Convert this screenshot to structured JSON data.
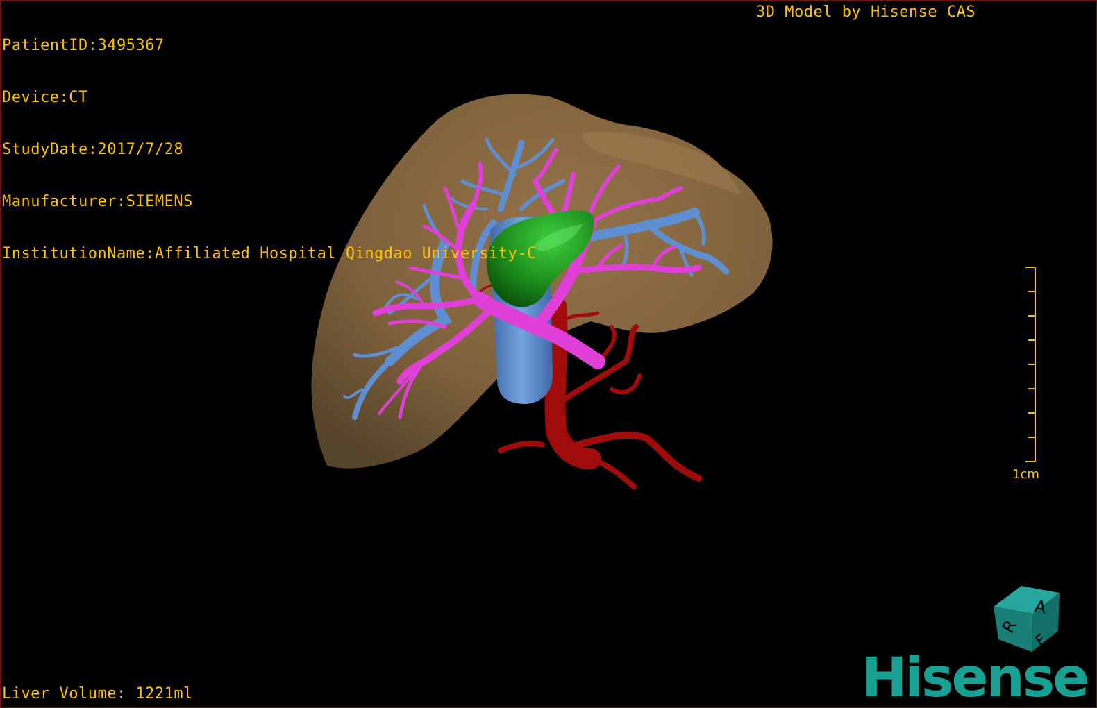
{
  "colors": {
    "overlay_text": "#ffc000",
    "liver": "#8f6d44",
    "hepatic_vein": "#5f8fd0",
    "portal_vein": "#e040d8",
    "hepatic_artery": "#a00c0c",
    "gallbladder": "#1a8a1a",
    "cube": "#1e8c84",
    "logo": "#18a093",
    "border": "#7a1010"
  },
  "dicom_info": {
    "patient_id": "PatientID:3495367",
    "device": "Device:CT",
    "study_date": "StudyDate:2017/7/28",
    "manufacturer": "Manufacturer:SIEMENS",
    "institution": "InstitutionName:Affiliated Hospital Qingdao University-C"
  },
  "model_credit": "3D Model by Hisense CAS",
  "liver_volume": "Liver Volume: 1221ml",
  "scale_bar": {
    "label": "1cm",
    "divisions": 8
  },
  "orientation_cube": {
    "top_face_letter": "A",
    "left_face_letter": "R",
    "front_face_letter": "F"
  },
  "brand": {
    "logo_text": "Hisense"
  }
}
